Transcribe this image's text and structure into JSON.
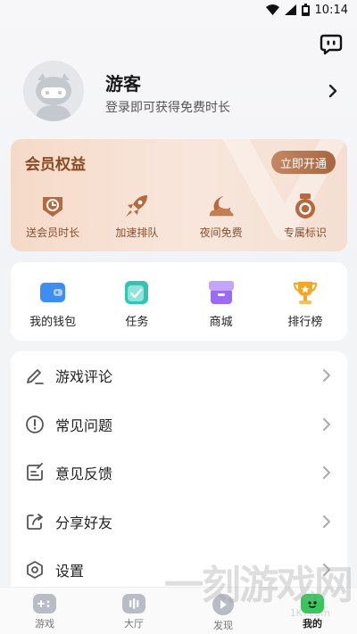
{
  "status_bar": {
    "time": "10:14"
  },
  "profile": {
    "username": "游客",
    "login_hint": "登录即可获得免费时长"
  },
  "vip": {
    "title": "会员权益",
    "open_label": "立即开通",
    "items": [
      {
        "label": "送会员时长",
        "icon": "clock-icon"
      },
      {
        "label": "加速排队",
        "icon": "rocket-icon"
      },
      {
        "label": "夜间免费",
        "icon": "moon-cloud-icon"
      },
      {
        "label": "专属标识",
        "icon": "badge-icon"
      }
    ]
  },
  "tools": [
    {
      "label": "我的钱包",
      "icon": "wallet-icon"
    },
    {
      "label": "任务",
      "icon": "task-icon"
    },
    {
      "label": "商城",
      "icon": "shop-icon"
    },
    {
      "label": "排行榜",
      "icon": "trophy-icon"
    }
  ],
  "menu": [
    {
      "label": "游戏评论",
      "icon": "pencil-icon"
    },
    {
      "label": "常见问题",
      "icon": "exclamation-icon"
    },
    {
      "label": "意见反馈",
      "icon": "feedback-icon"
    },
    {
      "label": "分享好友",
      "icon": "share-icon"
    },
    {
      "label": "设置",
      "icon": "settings-icon"
    }
  ],
  "tabbar": [
    {
      "label": "游戏",
      "icon": "gamepad-icon",
      "active": false
    },
    {
      "label": "大厅",
      "icon": "hall-icon",
      "active": false
    },
    {
      "label": "发现",
      "icon": "discover-icon",
      "active": false
    },
    {
      "label": "我的",
      "icon": "mine-icon",
      "active": true
    }
  ],
  "watermark": {
    "text": "一刻游戏网",
    "sub": "1KY.com"
  },
  "colors": {
    "accent_green": "#34c759",
    "vip_brown": "#a8663f",
    "tab_inactive": "#b8bcc6"
  }
}
